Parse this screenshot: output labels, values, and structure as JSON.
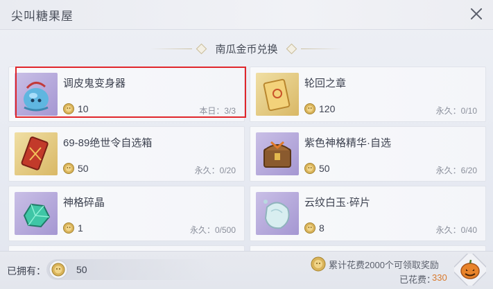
{
  "header": {
    "title": "尖叫糖果屋"
  },
  "section": {
    "title": "南瓜金币兑换"
  },
  "items": [
    {
      "name": "调皮鬼变身器",
      "price": "10",
      "limit": "本日：3/3",
      "icon": "blue-ghost-device-icon",
      "bg": "purple"
    },
    {
      "name": "轮回之章",
      "price": "120",
      "limit": "永久：0/10",
      "icon": "golden-scroll-icon",
      "bg": "gold"
    },
    {
      "name": "69-89绝世令自选箱",
      "price": "50",
      "limit": "永久：0/20",
      "icon": "red-token-box-icon",
      "bg": "gold"
    },
    {
      "name": "紫色神格精华·自选",
      "price": "50",
      "limit": "永久：6/20",
      "icon": "treasure-chest-icon",
      "bg": "purple"
    },
    {
      "name": "神格碎晶",
      "price": "1",
      "limit": "永久：0/500",
      "icon": "green-crystal-icon",
      "bg": "purple"
    },
    {
      "name": "云纹白玉·碎片",
      "price": "8",
      "limit": "永久：0/40",
      "icon": "white-jade-icon",
      "bg": "purple"
    }
  ],
  "footer": {
    "owned_label": "已拥有：",
    "owned_value": "50",
    "reward_text": "累计花费2000个可领取奖励",
    "spent_label": "已花费：",
    "spent_value": "330"
  },
  "colors": {
    "highlight": "#e0262b",
    "spent": "#d97a2e",
    "coin": "#d9b35a"
  }
}
